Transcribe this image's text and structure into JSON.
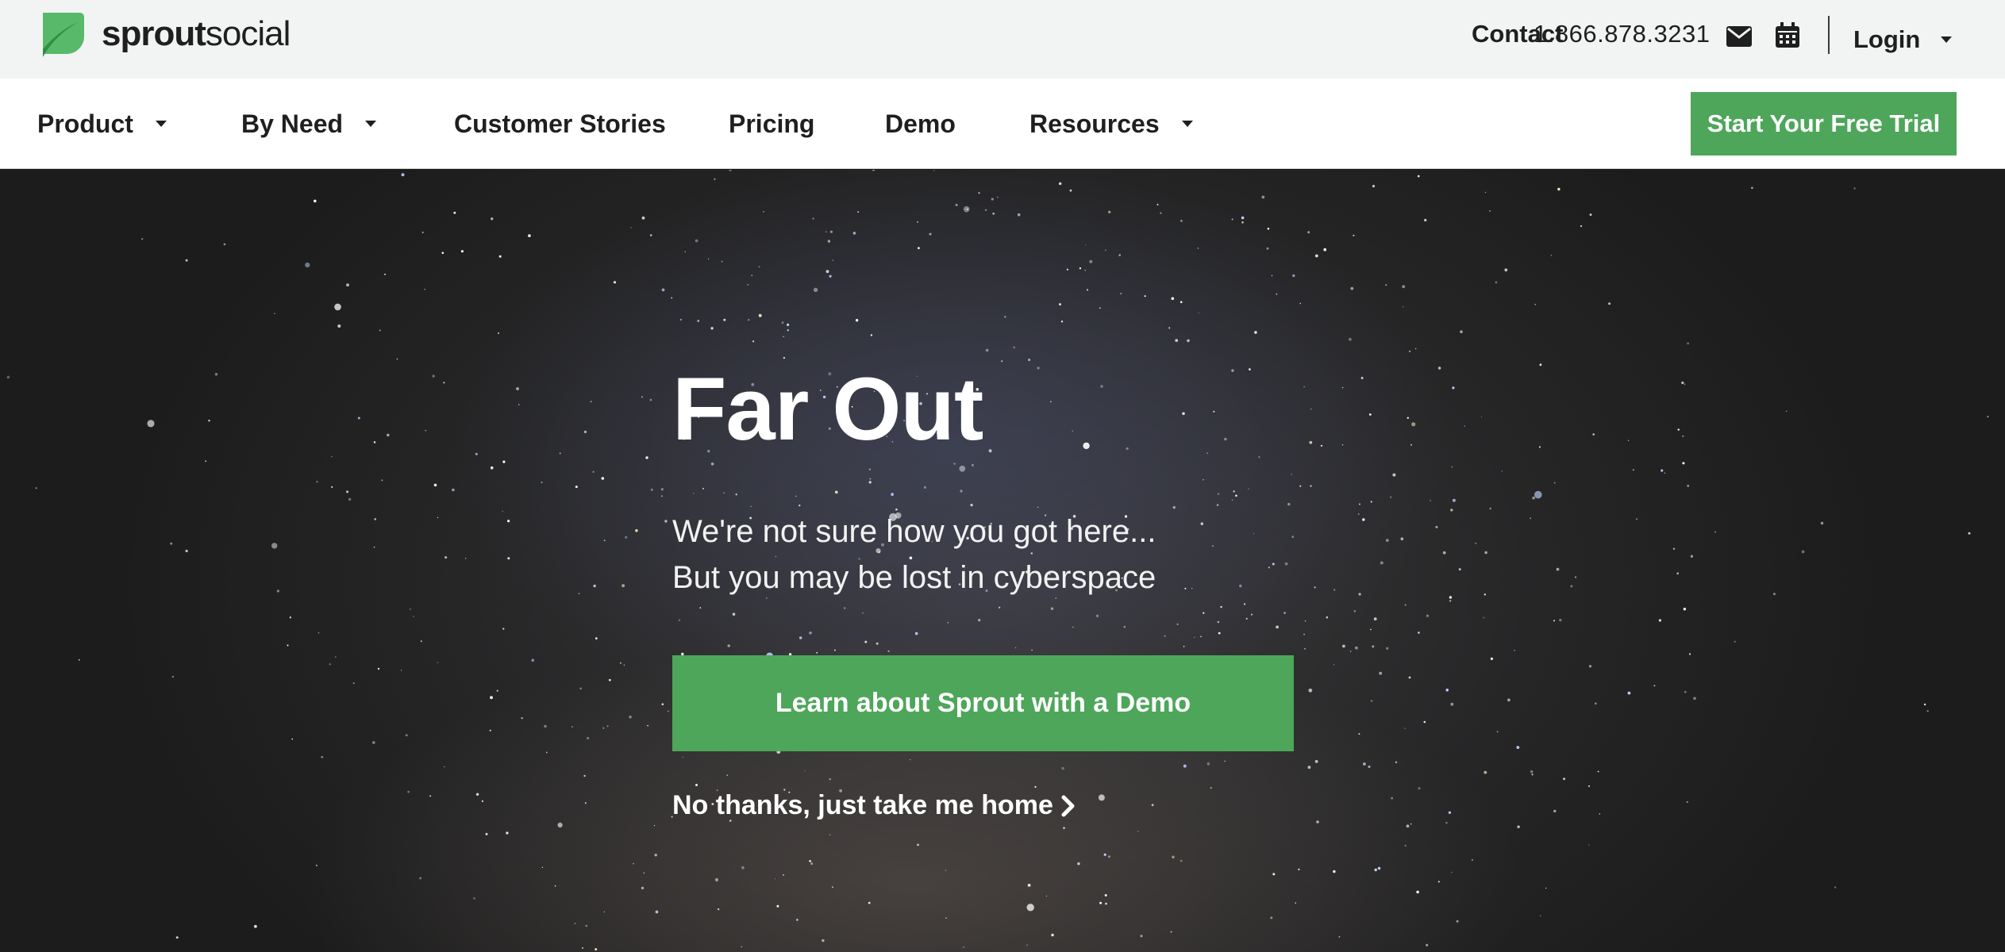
{
  "brand": {
    "logo_bold": "sprout",
    "logo_light": "social",
    "accent_color": "#4ea65a"
  },
  "utility": {
    "contact_label": "Contact",
    "phone": "1.866.878.3231",
    "mail_icon": "mail-icon",
    "calendar_icon": "calendar-icon",
    "login_label": "Login"
  },
  "nav": {
    "items": [
      {
        "label": "Product",
        "has_dropdown": true
      },
      {
        "label": "By Need",
        "has_dropdown": true
      },
      {
        "label": "Customer Stories",
        "has_dropdown": false
      },
      {
        "label": "Pricing",
        "has_dropdown": false
      },
      {
        "label": "Demo",
        "has_dropdown": false
      },
      {
        "label": "Resources",
        "has_dropdown": true
      }
    ],
    "cta_label": "Start Your Free Trial"
  },
  "hero": {
    "title": "Far Out",
    "line1": "We're not sure how you got here...",
    "line2": "But you may be lost in cyberspace",
    "demo_button": "Learn about Sprout with a Demo",
    "home_link": "No thanks, just take me home"
  }
}
